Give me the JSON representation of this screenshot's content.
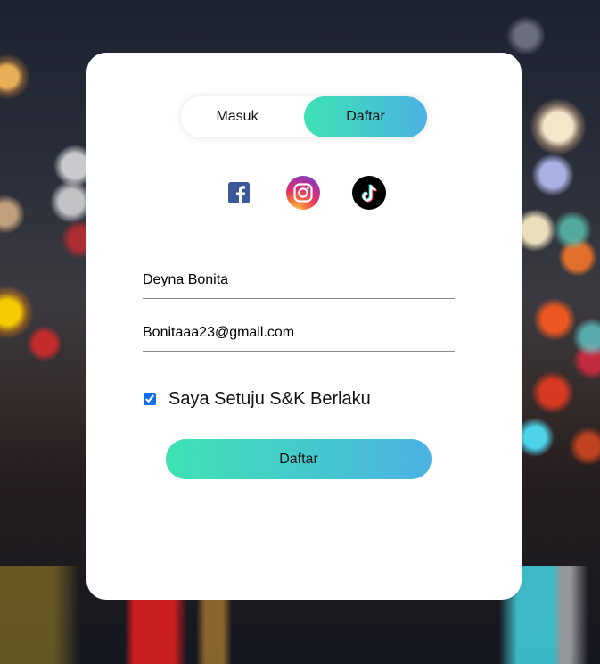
{
  "toggle": {
    "login_label": "Masuk",
    "register_label": "Daftar",
    "active_tab": "register"
  },
  "social": {
    "icons": [
      "facebook-icon",
      "instagram-icon",
      "tiktok-icon"
    ]
  },
  "form": {
    "name_value": "Deyna Bonita",
    "email_value": "Bonitaaa23@gmail.com",
    "agree_checked": true,
    "agree_label": "Saya Setuju S&K Berlaku",
    "submit_label": "Daftar"
  },
  "colors": {
    "gradient_start": "#3ee3b4",
    "gradient_end": "#4bb2e3",
    "facebook": "#3b5998",
    "checkbox": "#0b6ef5"
  }
}
